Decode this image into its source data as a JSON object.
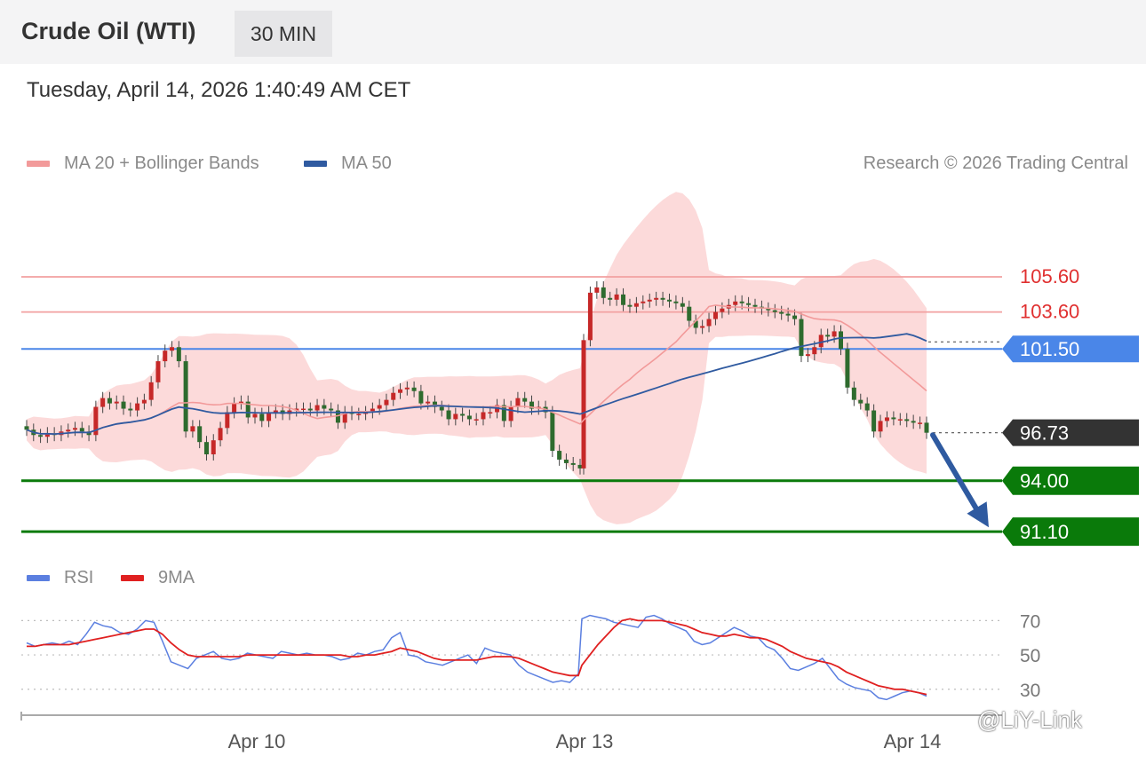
{
  "header": {
    "title": "Crude Oil (WTI)",
    "timeframe": "30 MIN",
    "datetime": "Tuesday, April 14, 2026 1:40:49 AM CET"
  },
  "legend": {
    "ma20": {
      "label": "MA 20 + Bollinger Bands",
      "color": "#f29a9a"
    },
    "ma50": {
      "label": "MA 50",
      "color": "#2f5aa0"
    },
    "credit": "Research © 2026 Trading Central"
  },
  "rsi_legend": {
    "rsi": {
      "label": "RSI",
      "color": "#5b7fe0"
    },
    "ma9": {
      "label": "9MA",
      "color": "#e02020"
    }
  },
  "watermark": "@LiY-Link",
  "chart_data": [
    {
      "type": "line",
      "name": "price",
      "x_ticks": [
        "Apr 10",
        "Apr 13",
        "Apr 14"
      ],
      "levels": [
        {
          "value": 105.6,
          "label": "105.60",
          "kind": "resistance",
          "color": "#f2a0a0",
          "text_color": "#e03030"
        },
        {
          "value": 103.6,
          "label": "103.60",
          "kind": "resistance",
          "color": "#f2a0a0",
          "text_color": "#e03030"
        },
        {
          "value": 101.5,
          "label": "101.50",
          "kind": "pivot",
          "color": "#4a86e8",
          "text_color": "#ffffff"
        },
        {
          "value": 96.73,
          "label": "96.73",
          "kind": "last",
          "color": "#333333",
          "text_color": "#ffffff"
        },
        {
          "value": 94.0,
          "label": "94.00",
          "kind": "support",
          "color": "#0a7a0a",
          "text_color": "#ffffff"
        },
        {
          "value": 91.1,
          "label": "91.10",
          "kind": "support",
          "color": "#0a7a0a",
          "text_color": "#ffffff"
        }
      ],
      "ylim": [
        90.3,
        110.5
      ],
      "closes": [
        96.9,
        96.6,
        96.5,
        96.7,
        96.6,
        96.8,
        96.9,
        97.0,
        96.8,
        96.6,
        98.2,
        98.7,
        98.4,
        98.5,
        98.1,
        98.0,
        98.4,
        98.6,
        99.6,
        100.8,
        101.4,
        101.6,
        100.8,
        96.8,
        97.1,
        96.2,
        95.5,
        96.3,
        97.0,
        97.9,
        98.4,
        98.5,
        97.6,
        97.8,
        97.4,
        97.9,
        98.0,
        97.8,
        98.0,
        98.1,
        98.1,
        98.0,
        98.3,
        98.1,
        98.0,
        97.3,
        97.9,
        97.8,
        97.8,
        97.9,
        98.1,
        98.3,
        98.6,
        99.0,
        99.2,
        99.3,
        99.1,
        98.4,
        98.5,
        98.2,
        98.0,
        97.5,
        97.8,
        97.7,
        97.5,
        97.5,
        97.9,
        97.9,
        98.3,
        97.4,
        98.2,
        98.7,
        98.5,
        98.1,
        98.2,
        97.9,
        95.7,
        95.2,
        95.0,
        94.9,
        94.7,
        102.0,
        104.7,
        105.0,
        104.4,
        104.3,
        104.6,
        104.0,
        103.9,
        104.1,
        104.2,
        104.3,
        104.4,
        104.3,
        104.2,
        104.1,
        103.9,
        103.1,
        102.7,
        102.8,
        103.2,
        103.6,
        103.8,
        104.0,
        104.2,
        104.1,
        104.0,
        103.9,
        103.8,
        103.7,
        103.6,
        103.5,
        103.4,
        103.2,
        101.1,
        101.2,
        101.6,
        102.3,
        102.2,
        102.5,
        101.5,
        99.3,
        98.6,
        98.4,
        98.0,
        96.8,
        97.4,
        97.6,
        97.5,
        97.5,
        97.4,
        97.3,
        97.3,
        96.73
      ]
    },
    {
      "type": "line",
      "name": "rsi",
      "series": [
        {
          "name": "RSI",
          "color": "#5b7fe0"
        },
        {
          "name": "9MA",
          "color": "#e02020"
        }
      ],
      "yticks": [
        70,
        50,
        30
      ],
      "ylim": [
        18,
        80
      ],
      "rsi": [
        57,
        55,
        56,
        57,
        56,
        58,
        56,
        62,
        69,
        67,
        66,
        63,
        62,
        65,
        70,
        69,
        58,
        46,
        44,
        42,
        48,
        50,
        52,
        48,
        47,
        48,
        51,
        50,
        49,
        48,
        52,
        51,
        50,
        51,
        50,
        50,
        49,
        47,
        48,
        51,
        50,
        52,
        53,
        60,
        63,
        50,
        49,
        46,
        45,
        44,
        46,
        48,
        50,
        45,
        54,
        52,
        51,
        50,
        44,
        40,
        38,
        36,
        34,
        35,
        34,
        39,
        71,
        73,
        72,
        71,
        69,
        68,
        67,
        66,
        72,
        73,
        71,
        68,
        66,
        64,
        58,
        56,
        57,
        60,
        63,
        66,
        64,
        61,
        60,
        55,
        53,
        48,
        42,
        41,
        43,
        45,
        48,
        42,
        36,
        33,
        31,
        30,
        29,
        25,
        24,
        26,
        28,
        29,
        28,
        26
      ],
      "ma9": [
        55,
        55,
        56,
        56,
        56,
        56,
        57,
        58,
        59,
        60,
        61,
        62,
        63,
        64,
        65,
        65,
        62,
        57,
        53,
        50,
        49,
        49,
        49,
        49,
        49,
        49,
        50,
        50,
        50,
        50,
        50,
        50,
        50,
        50,
        50,
        50,
        50,
        50,
        49,
        49,
        50,
        50,
        51,
        52,
        54,
        53,
        52,
        50,
        48,
        47,
        47,
        47,
        47,
        47,
        48,
        49,
        49,
        49,
        48,
        46,
        44,
        42,
        40,
        39,
        38,
        38,
        44,
        50,
        56,
        61,
        66,
        70,
        71,
        70,
        70,
        70,
        70,
        69,
        68,
        67,
        65,
        63,
        62,
        61,
        61,
        62,
        61,
        60,
        60,
        59,
        57,
        55,
        52,
        50,
        48,
        47,
        46,
        45,
        43,
        40,
        38,
        36,
        34,
        32,
        31,
        30,
        30,
        29,
        28,
        27
      ]
    }
  ]
}
